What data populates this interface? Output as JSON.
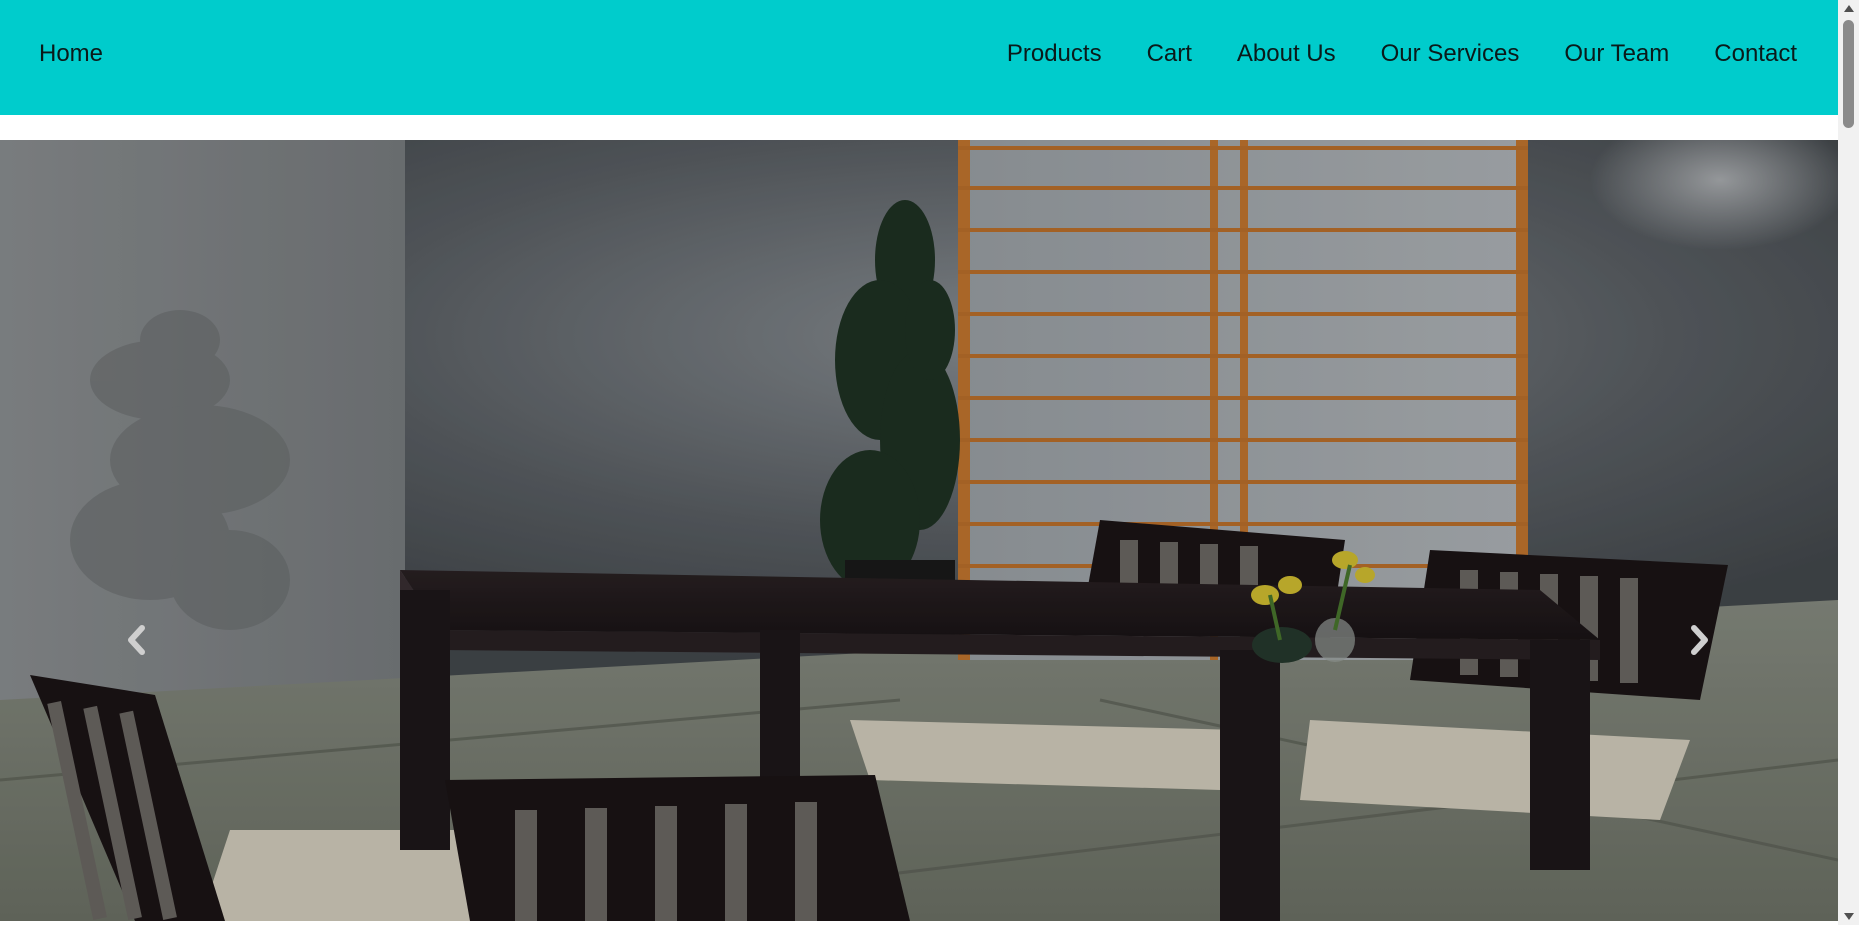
{
  "navbar": {
    "home_label": "Home",
    "links": [
      "Products",
      "Cart",
      "About Us",
      "Our Services",
      "Our Team",
      "Contact"
    ],
    "background_color": "#00cccc"
  },
  "carousel": {
    "prev_icon": "chevron-left-icon",
    "next_icon": "chevron-right-icon"
  },
  "scrollbar": {
    "up_icon": "triangle-up-icon",
    "down_icon": "triangle-down-icon"
  }
}
